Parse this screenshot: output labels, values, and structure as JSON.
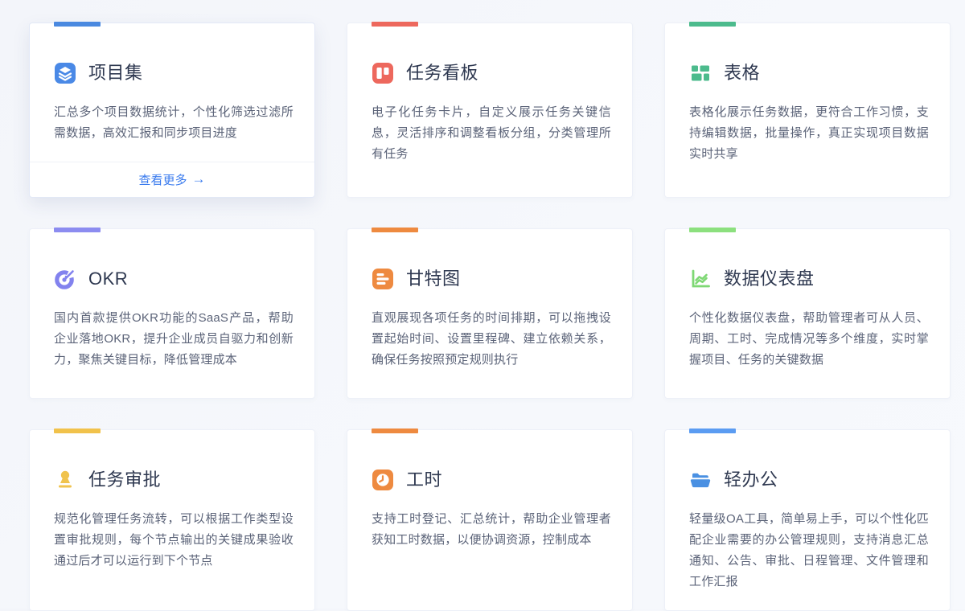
{
  "page": {
    "background": "#f6f8fc"
  },
  "cards": [
    {
      "id": "project-set",
      "title": "项目集",
      "desc": "汇总多个项目数据统计，个性化筛选过滤所需数据，高效汇报和同步项目进度",
      "accent": "#4a89e0",
      "icon_color": "#4a89e6",
      "icon": "layers-icon",
      "link_label": "查看更多",
      "link_arrow": "→"
    },
    {
      "id": "task-board",
      "title": "任务看板",
      "desc": "电子化任务卡片，自定义展示任务关键信息，灵活排序和调整看板分组，分类管理所有任务",
      "accent": "#ed685d",
      "icon_color": "#ed685d",
      "icon": "kanban-icon"
    },
    {
      "id": "table",
      "title": "表格",
      "desc": "表格化展示任务数据，更符合工作习惯，支持编辑数据，批量操作，真正实现项目数据实时共享",
      "accent": "#4cbb8d",
      "icon_color": "#4cbb8d",
      "icon": "table-grid-icon"
    },
    {
      "id": "okr",
      "title": "OKR",
      "desc": "国内首款提供OKR功能的SaaS产品，帮助企业落地OKR，提升企业成员自驱力和创新力，聚焦关键目标，降低管理成本",
      "accent": "#8c8cf0",
      "icon_color": "#8282ee",
      "icon": "okr-target-icon"
    },
    {
      "id": "gantt",
      "title": "甘特图",
      "desc": "直观展现各项任务的时间排期，可以拖拽设置起始时间、设置里程碑、建立依赖关系，确保任务按照预定规则执行",
      "accent": "#ee8a40",
      "icon_color": "#ee8a40",
      "icon": "gantt-icon"
    },
    {
      "id": "dashboard",
      "title": "数据仪表盘",
      "desc": "个性化数据仪表盘，帮助管理者可从人员、周期、工时、完成情况等多个维度，实时掌握项目、任务的关键数据",
      "accent": "#8ce07e",
      "icon_color": "#7ed874",
      "icon": "line-chart-icon"
    },
    {
      "id": "task-approval",
      "title": "任务审批",
      "desc": "规范化管理任务流转，可以根据工作类型设置审批规则，每个节点输出的关键成果验收通过后才可以运行到下个节点",
      "accent": "#f1c24b",
      "icon_color": "#f0c34d",
      "icon": "stamp-icon"
    },
    {
      "id": "work-hours",
      "title": "工时",
      "desc": "支持工时登记、汇总统计，帮助企业管理者获知工时数据，以便协调资源，控制成本",
      "accent": "#ee8a40",
      "icon_color": "#ee8a40",
      "icon": "clock-icon"
    },
    {
      "id": "light-office",
      "title": "轻办公",
      "desc": "轻量级OA工具，简单易上手，可以个性化匹配企业需要的办公管理规则，支持消息汇总通知、公告、审批、日程管理、文件管理和工作汇报",
      "accent": "#5b9cf2",
      "icon_color": "#4a90e2",
      "icon": "open-folder-icon"
    }
  ]
}
